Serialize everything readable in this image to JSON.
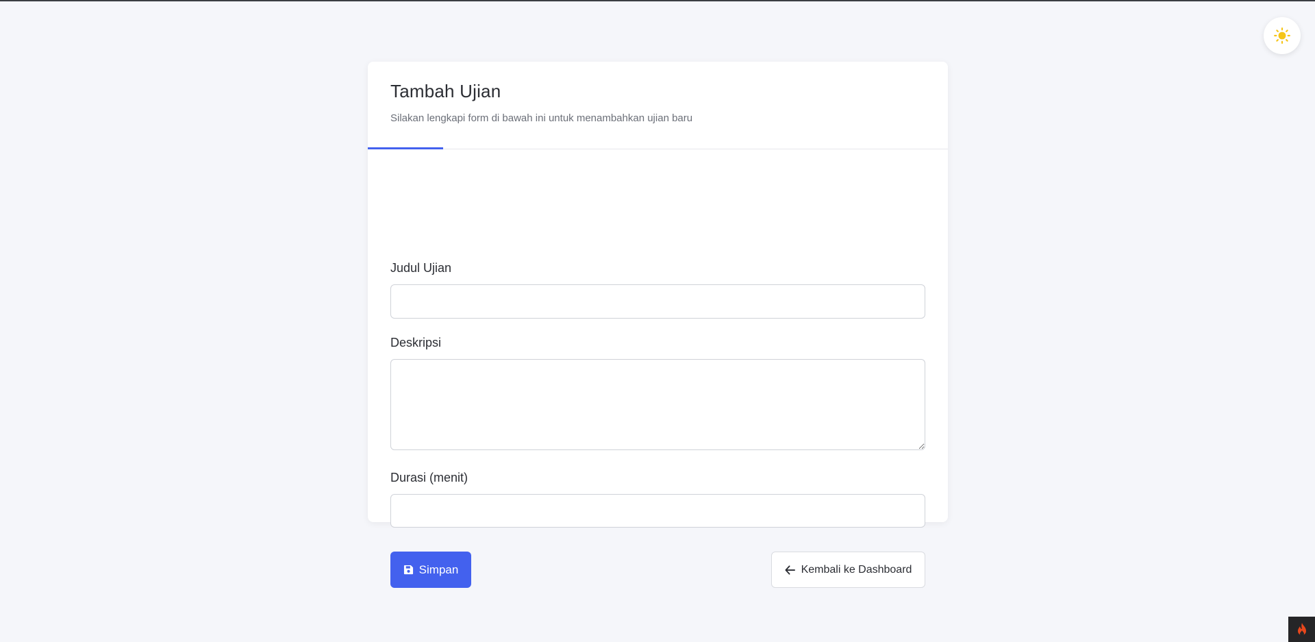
{
  "page": {
    "title": "Tambah Ujian",
    "subtitle": "Silakan lengkapi form di bawah ini untuk menambahkan ujian baru"
  },
  "form": {
    "title_field": {
      "label": "Judul Ujian",
      "value": "",
      "placeholder": ""
    },
    "description_field": {
      "label": "Deskripsi",
      "value": "",
      "placeholder": ""
    },
    "duration_field": {
      "label": "Durasi (menit)",
      "value": "",
      "placeholder": ""
    }
  },
  "actions": {
    "save_label": "Simpan",
    "back_label": "Kembali ke Dashboard"
  },
  "icons": {
    "theme_toggle": "sun-icon",
    "save": "floppy-disk-icon",
    "back": "arrow-left-icon",
    "corner_badge": "flame-icon"
  },
  "colors": {
    "accent": "#4361ee",
    "sun": "#f5c518",
    "flame": "#e8471c",
    "background": "#f5f6fa"
  }
}
